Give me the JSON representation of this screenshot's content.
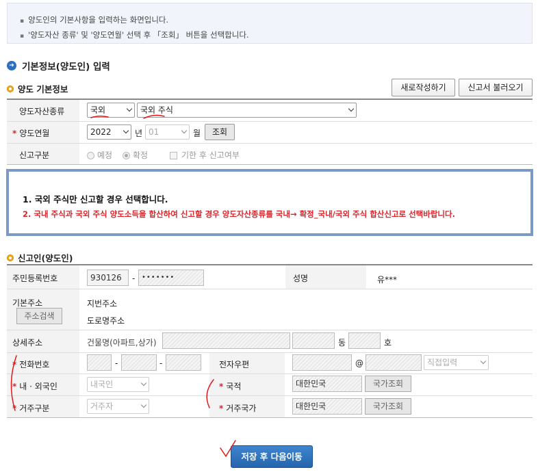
{
  "notice": {
    "line1": "양도인의 기본사항을 입력하는 화면입니다.",
    "line2": "'양도자산 종류' 및 '양도연월' 선택 후 「조회」 버튼을 선택합니다."
  },
  "section_main": {
    "title": "기본정보(양도인) 입력"
  },
  "basic": {
    "title": "양도 기본정보",
    "btn_new": "새로작성하기",
    "btn_load": "신고서 불러오기",
    "asset_type_label": "양도자산종류",
    "asset_type_1": "국외",
    "asset_type_2": "국외 주식",
    "ym_label": "양도연월",
    "year": "2022",
    "year_unit": "년",
    "month": "01",
    "month_unit": "월",
    "btn_search": "조회",
    "report_type_label": "신고구분",
    "radio_scheduled": "예정",
    "radio_final": "확정",
    "late_report": "기한 후 신고여부"
  },
  "info": {
    "line1": "1. 국외 주식만 신고할 경우 선택합니다.",
    "line2": "2. 국내 주식과 국외 주식 양도소득을 합산하여 신고할 경우 양도자산종류를 국내→ 확정_국내/국외 주식 합산신고로 선택바랍니다."
  },
  "reporter": {
    "title": "신고인(양도인)",
    "rrn_label": "주민등록번호",
    "rrn_front": "930126",
    "rrn_dash": "-",
    "rrn_back": "•••••••",
    "name_label": "성명",
    "name_value": "유***",
    "addr_label": "기본주소",
    "addr_btn": "주소검색",
    "jibun": "지번주소",
    "road": "도로명주소",
    "detail_label": "상세주소",
    "bldg": "건물명(아파트,상가)",
    "dong": "동",
    "ho": "호",
    "phone_label": "전화번호",
    "dash": "-",
    "email_label": "전자우편",
    "at": "@",
    "email_direct": "직접입력",
    "resident_label": "내 · 외국인",
    "resident_value": "내국인",
    "nationality_label": "국적",
    "nationality_value": "대한민국",
    "country_btn": "국가조회",
    "residency_label": "거주구분",
    "residency_value": "거주자",
    "res_country_label": "거주국가",
    "res_country_value": "대한민국"
  },
  "save_btn": "저장 후 다음이동"
}
